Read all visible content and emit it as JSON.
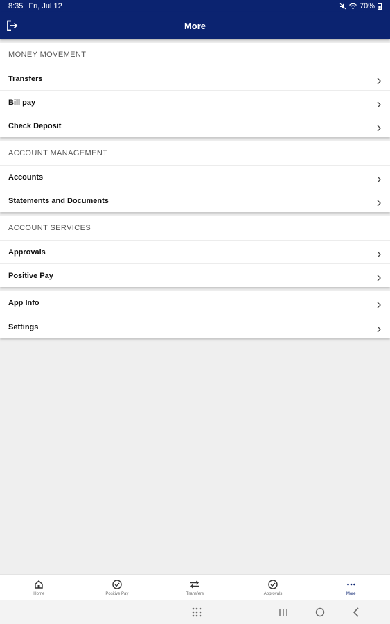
{
  "status_bar": {
    "time": "8:35",
    "date": "Fri, Jul 12",
    "battery": "70%"
  },
  "header": {
    "title": "More"
  },
  "sections": [
    {
      "title": "MONEY MOVEMENT",
      "items": [
        {
          "label": "Transfers"
        },
        {
          "label": "Bill pay"
        },
        {
          "label": "Check Deposit"
        }
      ]
    },
    {
      "title": "ACCOUNT MANAGEMENT",
      "items": [
        {
          "label": "Accounts"
        },
        {
          "label": "Statements and Documents"
        }
      ]
    },
    {
      "title": "ACCOUNT SERVICES",
      "items": [
        {
          "label": "Approvals"
        },
        {
          "label": "Positive Pay"
        }
      ]
    },
    {
      "title": "",
      "items": [
        {
          "label": "App Info"
        },
        {
          "label": "Settings"
        }
      ]
    }
  ],
  "bottom_nav": [
    {
      "label": "Home",
      "icon": "home-icon"
    },
    {
      "label": "Positive Pay",
      "icon": "check-circle-icon"
    },
    {
      "label": "Transfers",
      "icon": "transfer-arrows-icon"
    },
    {
      "label": "Approvals",
      "icon": "check-circle-icon"
    },
    {
      "label": "More",
      "icon": "more-dots-icon",
      "active": true
    }
  ],
  "colors": {
    "header_bg": "#0b2370",
    "active_nav": "#0b2370",
    "page_bg": "#efefef"
  }
}
